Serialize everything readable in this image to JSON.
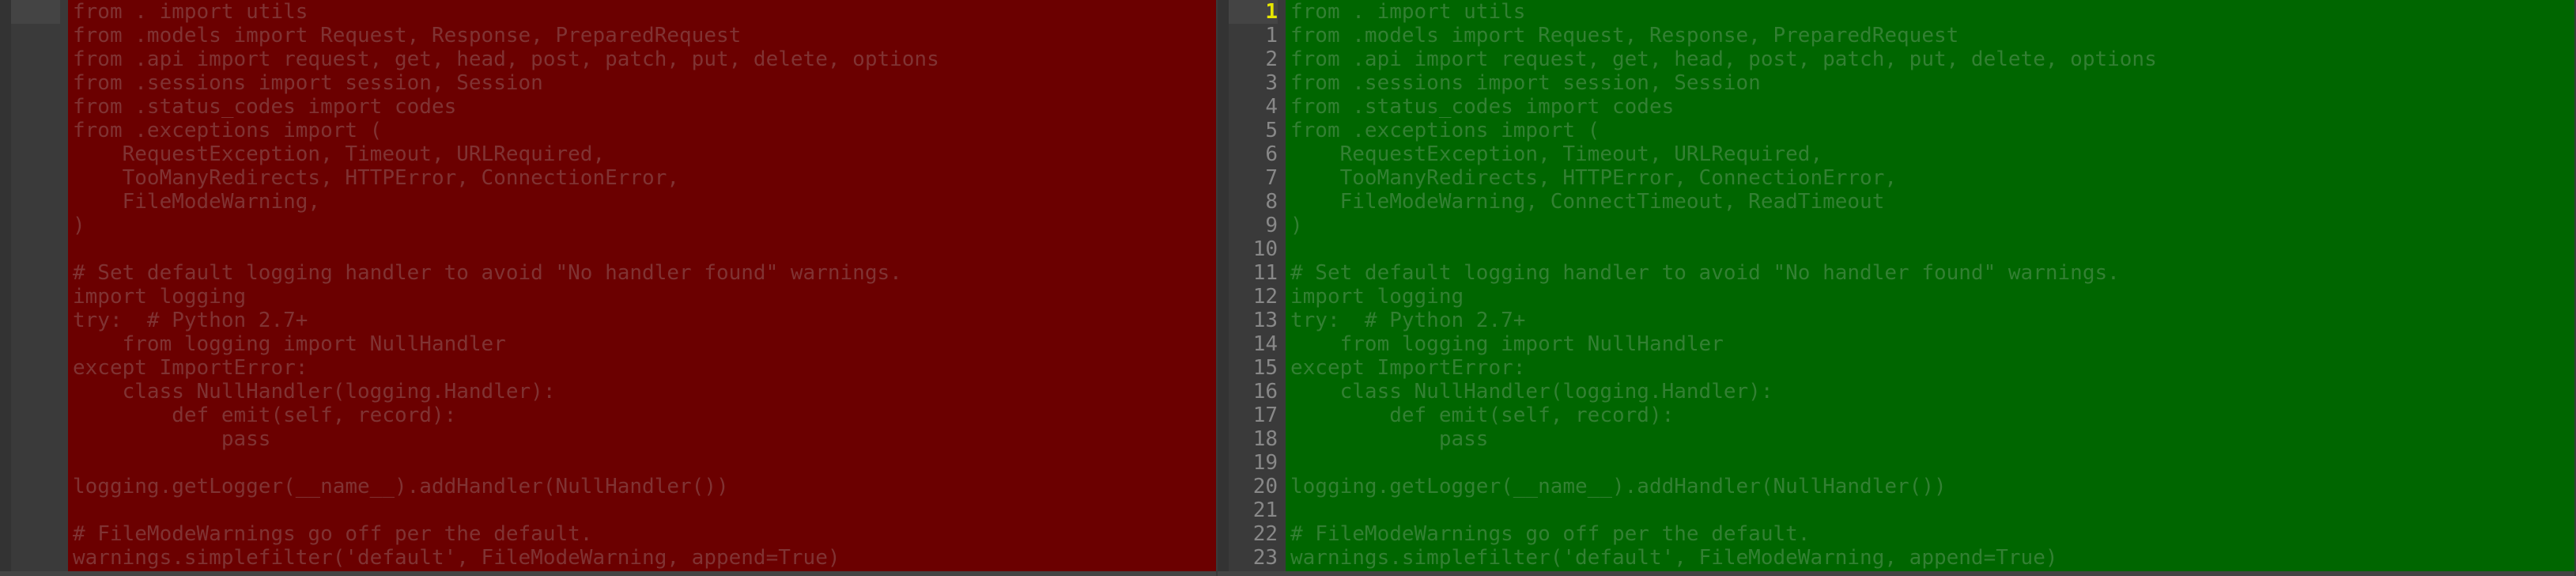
{
  "left": {
    "current_line": 1,
    "gutter": [
      ""
    ],
    "lines": [
      "from . import utils",
      "from .models import Request, Response, PreparedRequest",
      "from .api import request, get, head, post, patch, put, delete, options",
      "from .sessions import session, Session",
      "from .status_codes import codes",
      "from .exceptions import (",
      "    RequestException, Timeout, URLRequired,",
      "    TooManyRedirects, HTTPError, ConnectionError,",
      "    FileModeWarning,",
      ")",
      "",
      "# Set default logging handler to avoid \"No handler found\" warnings.",
      "import logging",
      "try:  # Python 2.7+",
      "    from logging import NullHandler",
      "except ImportError:",
      "    class NullHandler(logging.Handler):",
      "        def emit(self, record):",
      "            pass",
      "",
      "logging.getLogger(__name__).addHandler(NullHandler())",
      "",
      "# FileModeWarnings go off per the default.",
      "warnings.simplefilter('default', FileModeWarning, append=True)"
    ]
  },
  "right": {
    "current_line": 1,
    "gutter": [
      "1",
      "1",
      "2",
      "3",
      "4",
      "5",
      "6",
      "7",
      "8",
      "9",
      "10",
      "11",
      "12",
      "13",
      "14",
      "15",
      "16",
      "17",
      "18",
      "19",
      "20",
      "21",
      "22",
      "23"
    ],
    "lines": [
      "from . import utils",
      "from .models import Request, Response, PreparedRequest",
      "from .api import request, get, head, post, patch, put, delete, options",
      "from .sessions import session, Session",
      "from .status_codes import codes",
      "from .exceptions import (",
      "    RequestException, Timeout, URLRequired,",
      "    TooManyRedirects, HTTPError, ConnectionError,",
      "    FileModeWarning, ConnectTimeout, ReadTimeout",
      ")",
      "",
      "# Set default logging handler to avoid \"No handler found\" warnings.",
      "import logging",
      "try:  # Python 2.7+",
      "    from logging import NullHandler",
      "except ImportError:",
      "    class NullHandler(logging.Handler):",
      "        def emit(self, record):",
      "            pass",
      "",
      "logging.getLogger(__name__).addHandler(NullHandler())",
      "",
      "# FileModeWarnings go off per the default.",
      "warnings.simplefilter('default', FileModeWarning, append=True)"
    ]
  }
}
